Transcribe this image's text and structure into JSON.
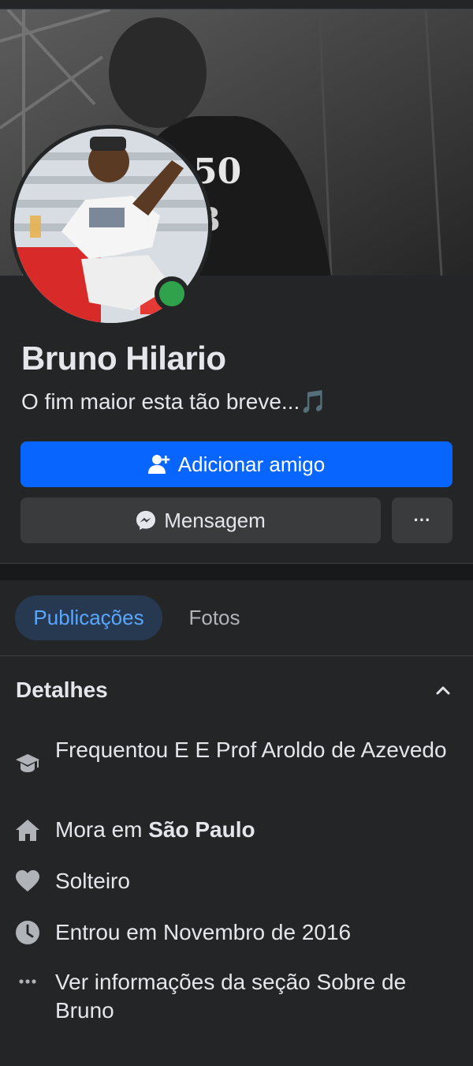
{
  "profile": {
    "name": "Bruno Hilario",
    "bio": "O fim maior esta tão breve...",
    "bio_emoji": "🎵"
  },
  "actions": {
    "add_friend_label": "Adicionar amigo",
    "message_label": "Mensagem",
    "more_label": "···"
  },
  "tabs": [
    {
      "label": "Publicações",
      "active": true
    },
    {
      "label": "Fotos",
      "active": false
    }
  ],
  "details": {
    "title": "Detalhes",
    "items": [
      {
        "icon": "graduation-cap-icon",
        "text": "Frequentou E E Prof Aroldo de Azevedo"
      },
      {
        "icon": "home-icon",
        "prefix": "Mora em ",
        "bold": "São Paulo"
      },
      {
        "icon": "heart-icon",
        "text": "Solteiro"
      },
      {
        "icon": "clock-icon",
        "text": "Entrou em Novembro de 2016"
      },
      {
        "icon": "more-dots-icon",
        "text": "Ver informações da seção Sobre de Bruno"
      }
    ]
  },
  "colors": {
    "background": "#242526",
    "primary_button": "#0866ff",
    "secondary_button": "#3a3b3c",
    "active_tab_bg": "#263951",
    "active_tab_text": "#5aa7ff",
    "online": "#31a24c"
  }
}
